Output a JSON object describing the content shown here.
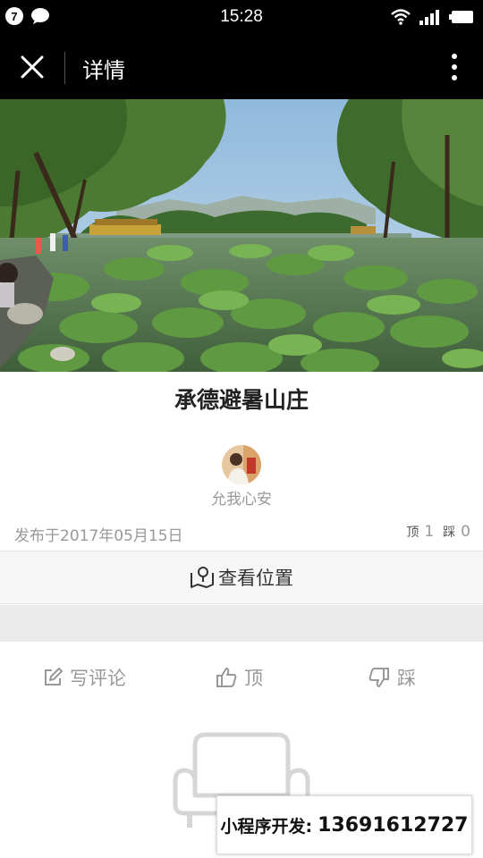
{
  "status_bar": {
    "notification_count": "7",
    "time": "15:28",
    "icons": [
      "chat-bubble-icon",
      "wifi-icon",
      "signal-icon",
      "battery-icon"
    ]
  },
  "header": {
    "title": "详情"
  },
  "post": {
    "place_name": "承德避暑山庄",
    "author_name": "允我心安",
    "publish_date": "发布于2017年05月15日",
    "up_label": "顶",
    "up_count": "1",
    "down_label": "踩",
    "down_count": "0"
  },
  "location": {
    "label": "查看位置"
  },
  "actions": {
    "comment_label": "写评论",
    "up_label": "顶",
    "down_label": "踩"
  },
  "watermark": {
    "label": "小程序开发:",
    "phone": "13691612727"
  },
  "colors": {
    "bar_background": "#000000",
    "muted_text": "#999999",
    "location_background": "#f6f6f6",
    "separator_band": "#ebebeb"
  }
}
